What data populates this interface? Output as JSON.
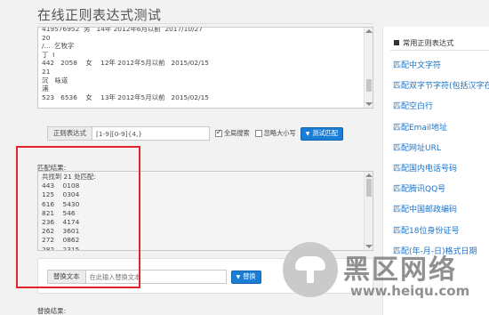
{
  "page": {
    "title": "在线正则表达式测试"
  },
  "source": {
    "lines": [
      "419576952  男   14年 2012年6月以前  2017/10/27",
      "20",
      "/...  乞牧字",
      "丁  I",
      "442   2058    女    12年 2012年5月以前   2015/02/15",
      "21",
      "沉   咏道",
      "浦",
      "523   6536    女    13年 2012年5月以前   2015/02/15"
    ]
  },
  "regex_bar": {
    "label": "正则表达式",
    "value": "[1-9][0-9]{4,}",
    "global_label": "全局搜索",
    "global_checked": true,
    "ignore_case_label": "忽略大小写",
    "ignore_case_checked": false,
    "test_button": "测试匹配"
  },
  "result": {
    "label": "匹配结果:",
    "lines": [
      "共找到 21 处匹配:",
      "443    0108",
      "125    0304",
      "616    5430",
      "821    546",
      "236    4174",
      "262    3601",
      "272    0862",
      "282    2315"
    ]
  },
  "replace": {
    "label": "替换文本",
    "placeholder": "在此输入替换文本",
    "button": "替换",
    "result_label": "替换结果:"
  },
  "sidebar": {
    "title": "常用正则表达式",
    "items": [
      "匹配中文字符",
      "匹配双字节字符(包括汉字在内)",
      "匹配空白行",
      "匹配Email地址",
      "匹配网址URL",
      "匹配国内电话号码",
      "匹配腾讯QQ号",
      "匹配中国邮政编码",
      "匹配18位身份证号",
      "匹配(年-月-日)格式日期"
    ]
  },
  "watermark": {
    "brand": "黑区网络",
    "url": "www.heiqu.com"
  },
  "colors": {
    "accent": "#1a7dd6",
    "link": "#1a73c8",
    "highlight": "#e0262c"
  }
}
